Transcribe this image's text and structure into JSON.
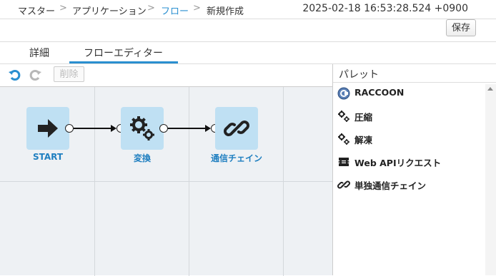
{
  "breadcrumb": {
    "items": [
      "マスター",
      "アプリケーション",
      "フロー",
      "新規作成"
    ],
    "separator": ">"
  },
  "timestamp": "2025-02-18 16:53:28.524 +0900",
  "save_label": "保存",
  "tabs": [
    {
      "label": "詳細",
      "active": false
    },
    {
      "label": "フローエディター",
      "active": true
    }
  ],
  "toolbar": {
    "undo_icon": "undo-icon",
    "redo_icon": "redo-icon",
    "delete_label": "削除"
  },
  "flow": {
    "nodes": [
      {
        "label": "START",
        "icon": "arrow-right-icon"
      },
      {
        "label": "変換",
        "icon": "gears-icon"
      },
      {
        "label": "通信チェイン",
        "icon": "link-icon"
      }
    ]
  },
  "palette": {
    "title": "パレット",
    "items": [
      {
        "label": "RACCOON",
        "icon": "raccoon-icon"
      },
      {
        "label": "圧縮",
        "icon": "gears-icon"
      },
      {
        "label": "解凍",
        "icon": "gears-icon"
      },
      {
        "label": "Web APIリクエスト",
        "icon": "web-api-icon"
      },
      {
        "label": "単独通信チェイン",
        "icon": "link-icon"
      }
    ]
  },
  "colors": {
    "accent": "#2a8fd0",
    "node_bg": "#bfe0f3",
    "canvas_bg": "#eef1f4"
  }
}
